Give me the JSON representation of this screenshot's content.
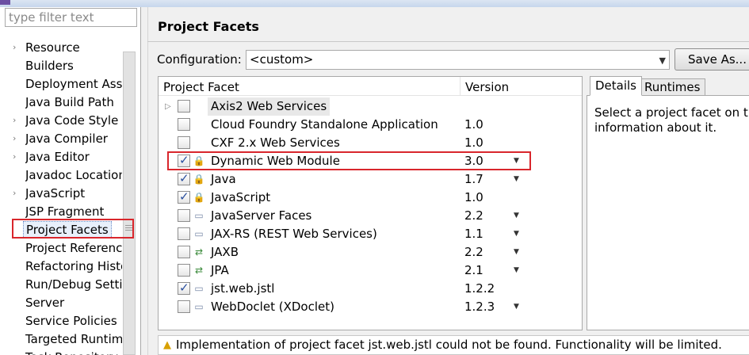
{
  "filter": {
    "placeholder": "type filter text"
  },
  "tree": [
    {
      "label": "Resource",
      "expandable": true
    },
    {
      "label": "Builders",
      "expandable": false
    },
    {
      "label": "Deployment Assembly",
      "expandable": false
    },
    {
      "label": "Java Build Path",
      "expandable": false
    },
    {
      "label": "Java Code Style",
      "expandable": true
    },
    {
      "label": "Java Compiler",
      "expandable": true
    },
    {
      "label": "Java Editor",
      "expandable": true
    },
    {
      "label": "Javadoc Location",
      "expandable": false
    },
    {
      "label": "JavaScript",
      "expandable": true
    },
    {
      "label": "JSP Fragment",
      "expandable": false
    },
    {
      "label": "Project Facets",
      "expandable": false,
      "selected": true
    },
    {
      "label": "Project References",
      "expandable": false
    },
    {
      "label": "Refactoring History",
      "expandable": false
    },
    {
      "label": "Run/Debug Settings",
      "expandable": false
    },
    {
      "label": "Server",
      "expandable": false
    },
    {
      "label": "Service Policies",
      "expandable": false
    },
    {
      "label": "Targeted Runtimes",
      "expandable": false
    },
    {
      "label": "Task Repository",
      "expandable": false
    }
  ],
  "page": {
    "title": "Project Facets",
    "configuration_label": "Configuration:",
    "configuration_value": "<custom>",
    "save_as_label": "Save As..."
  },
  "table": {
    "col_facet": "Project Facet",
    "col_version": "Version",
    "rows": [
      {
        "name": "Axis2 Web Services",
        "version": "",
        "checked": false,
        "dropdown": false,
        "icon": "expand-icon"
      },
      {
        "name": "Cloud Foundry Standalone Application",
        "version": "1.0",
        "checked": false,
        "dropdown": false,
        "icon": ""
      },
      {
        "name": "CXF 2.x Web Services",
        "version": "1.0",
        "checked": false,
        "dropdown": false,
        "icon": ""
      },
      {
        "name": "Dynamic Web Module",
        "version": "3.0",
        "checked": true,
        "dropdown": true,
        "icon": "facet-lock-icon"
      },
      {
        "name": "Java",
        "version": "1.7",
        "checked": true,
        "dropdown": true,
        "icon": "facet-lock-icon"
      },
      {
        "name": "JavaScript",
        "version": "1.0",
        "checked": true,
        "dropdown": false,
        "icon": "facet-lock-icon"
      },
      {
        "name": "JavaServer Faces",
        "version": "2.2",
        "checked": false,
        "dropdown": true,
        "icon": "page-icon"
      },
      {
        "name": "JAX-RS (REST Web Services)",
        "version": "1.1",
        "checked": false,
        "dropdown": true,
        "icon": "page-icon"
      },
      {
        "name": "JAXB",
        "version": "2.2",
        "checked": false,
        "dropdown": true,
        "icon": "arrows-icon"
      },
      {
        "name": "JPA",
        "version": "2.1",
        "checked": false,
        "dropdown": true,
        "icon": "arrows-icon"
      },
      {
        "name": "jst.web.jstl",
        "version": "1.2.2",
        "checked": true,
        "dropdown": false,
        "icon": "page-icon"
      },
      {
        "name": "WebDoclet (XDoclet)",
        "version": "1.2.3",
        "checked": false,
        "dropdown": true,
        "icon": "page-icon"
      }
    ]
  },
  "details": {
    "tab_details": "Details",
    "tab_runtimes": "Runtimes",
    "text_line1": "Select a project facet on th",
    "text_line2": "information about it."
  },
  "status": {
    "message": "Implementation of project facet jst.web.jstl could not be found. Functionality will be limited."
  },
  "colors": {
    "highlight_box": "#d9262c",
    "check": "#2a4f9e",
    "warning": "#d8a000"
  }
}
